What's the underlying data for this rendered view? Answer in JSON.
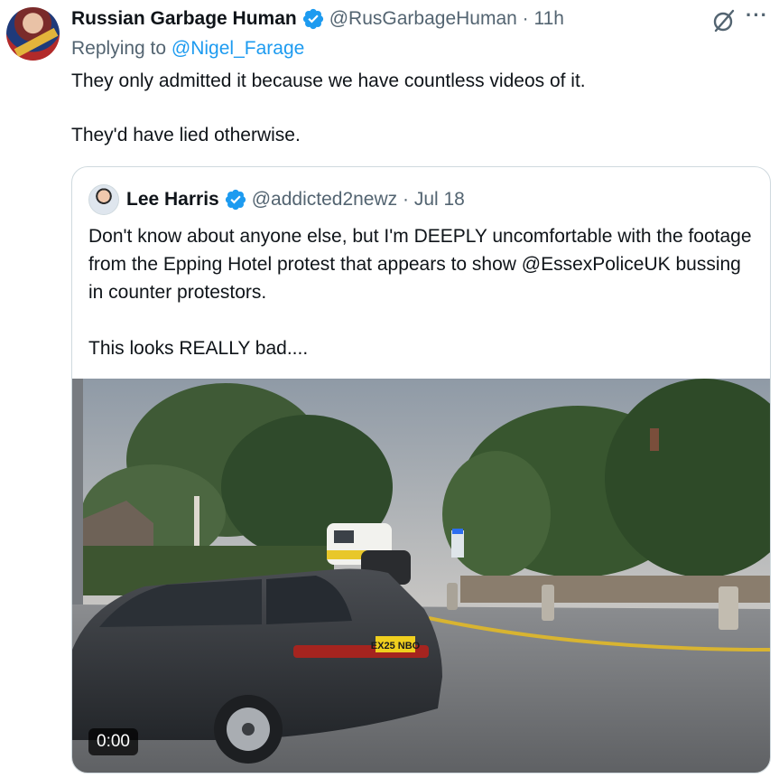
{
  "tweet": {
    "author_name": "Russian Garbage Human",
    "author_handle": "@RusGarbageHuman · 11h",
    "replying_prefix": "Replying to ",
    "replying_to": "@Nigel_Farage",
    "text_line1": "They only admitted it because we have countless videos of it.",
    "text_line2": "They'd have lied otherwise.",
    "more_label": "···"
  },
  "quote": {
    "author_name": "Lee Harris",
    "author_handle": "@addicted2newz · Jul 18",
    "text_para1": "Don't know about anyone else, but I'm DEEPLY uncomfortable with the footage from the Epping Hotel protest that appears to show @EssexPoliceUK bussing in counter protestors.",
    "text_para2": "This looks REALLY bad....",
    "video_duration": "0:00",
    "plate_text": "EX25 NBO"
  },
  "colors": {
    "verified_blue": "#1d9bf0",
    "link_blue": "#1d9bf0",
    "secondary_text": "#536471",
    "border": "#cfd9de"
  },
  "icons": [
    "verified-badge-icon",
    "grok-icon",
    "more-icon",
    "play-duration-badge"
  ]
}
